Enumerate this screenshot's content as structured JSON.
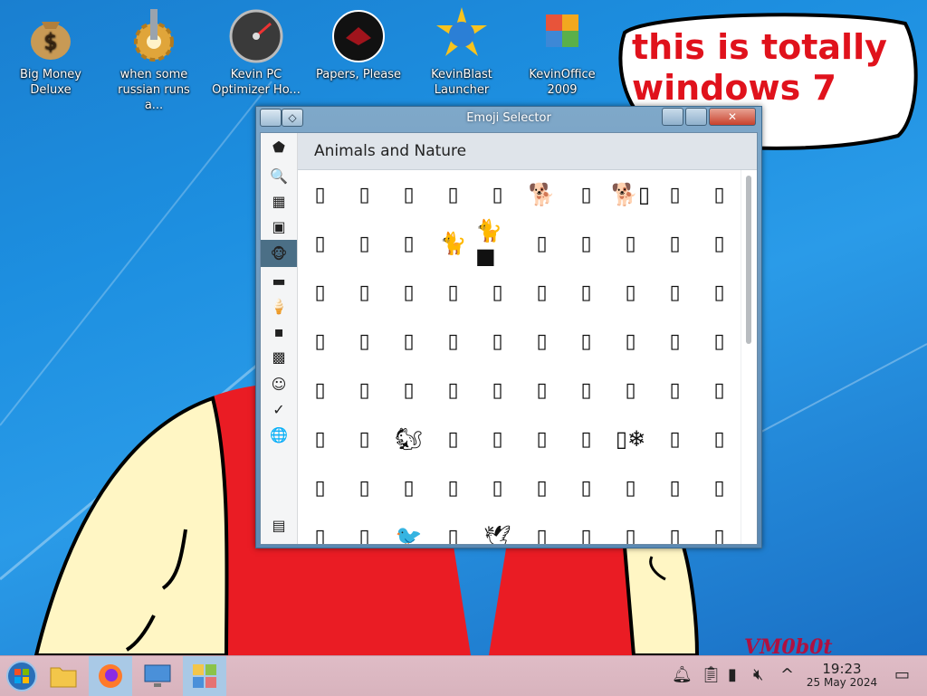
{
  "desktop": {
    "icons": [
      {
        "name": "money-bag-icon",
        "label": "Big Money Deluxe"
      },
      {
        "name": "gear-icon",
        "label": "when some russian runs a..."
      },
      {
        "name": "speedometer-icon",
        "label": "Kevin PC Optimizer Ho..."
      },
      {
        "name": "papers-please-icon",
        "label": "Papers, Please"
      },
      {
        "name": "kevinblast-icon",
        "label": "KevinBlast Launcher"
      },
      {
        "name": "office-icon",
        "label": "KevinOffice 2009"
      }
    ],
    "speech_bubble": "this is totally windows 7 guys",
    "watermark": "VM0b0t"
  },
  "window": {
    "title": "Emoji Selector",
    "category_title": "Animals and Nature",
    "sidebar": [
      {
        "name": "sidebar-item-recent",
        "glyph": "⬟"
      },
      {
        "name": "sidebar-item-search",
        "glyph": "🔍"
      },
      {
        "name": "sidebar-item-smileys",
        "glyph": "▦"
      },
      {
        "name": "sidebar-item-people",
        "glyph": "▣"
      },
      {
        "name": "sidebar-item-animals",
        "glyph": "🐵",
        "active": true
      },
      {
        "name": "sidebar-item-food",
        "glyph": "▬"
      },
      {
        "name": "sidebar-item-activities",
        "glyph": "🍦"
      },
      {
        "name": "sidebar-item-travel",
        "glyph": "▪"
      },
      {
        "name": "sidebar-item-objects",
        "glyph": "▩"
      },
      {
        "name": "sidebar-item-symbols",
        "glyph": "☺"
      },
      {
        "name": "sidebar-item-check",
        "glyph": "✓"
      },
      {
        "name": "sidebar-item-flags",
        "glyph": "🌐"
      },
      {
        "name": "sidebar-item-settings",
        "glyph": "▤"
      }
    ],
    "emoji_rows": [
      [
        "▯",
        "▯",
        "▯",
        "▯",
        "▯",
        "🐕",
        "▯",
        "🐕▯",
        "▯",
        "▯"
      ],
      [
        "▯",
        "▯",
        "▯",
        "🐈",
        "🐈■",
        "▯",
        "▯",
        "▯",
        "▯",
        "▯"
      ],
      [
        "▯",
        "▯",
        "▯",
        "▯",
        "▯",
        "▯",
        "▯",
        "▯",
        "▯",
        "▯"
      ],
      [
        "▯",
        "▯",
        "▯",
        "▯",
        "▯",
        "▯",
        "▯",
        "▯",
        "▯",
        "▯"
      ],
      [
        "▯",
        "▯",
        "▯",
        "▯",
        "▯",
        "▯",
        "▯",
        "▯",
        "▯",
        "▯"
      ],
      [
        "▯",
        "▯",
        "🐿",
        "▯",
        "▯",
        "▯",
        "▯",
        "▯❄",
        "▯",
        "▯"
      ],
      [
        "▯",
        "▯",
        "▯",
        "▯",
        "▯",
        "▯",
        "▯",
        "▯",
        "▯",
        "▯"
      ],
      [
        "▯",
        "▯",
        "🐦",
        "▯",
        "🕊",
        "▯",
        "▯",
        "▯",
        "▯",
        "▯"
      ]
    ]
  },
  "taskbar": {
    "apps": [
      {
        "name": "start-button",
        "glyph": "⊞"
      },
      {
        "name": "file-manager-icon",
        "glyph": "📁"
      },
      {
        "name": "firefox-icon",
        "glyph": "◉"
      },
      {
        "name": "remote-desktop-icon",
        "glyph": "▣"
      },
      {
        "name": "emoji-selector-taskbar-icon",
        "glyph": "▦",
        "active": true
      }
    ],
    "tray": {
      "time": "19:23",
      "date": "25 May 2024"
    }
  },
  "colors": {
    "desktop_blue": "#1d8fe0",
    "bubble_text": "#e0121c",
    "taskbar": "#dfbcc6",
    "sidebar_active": "#4b6f86"
  }
}
